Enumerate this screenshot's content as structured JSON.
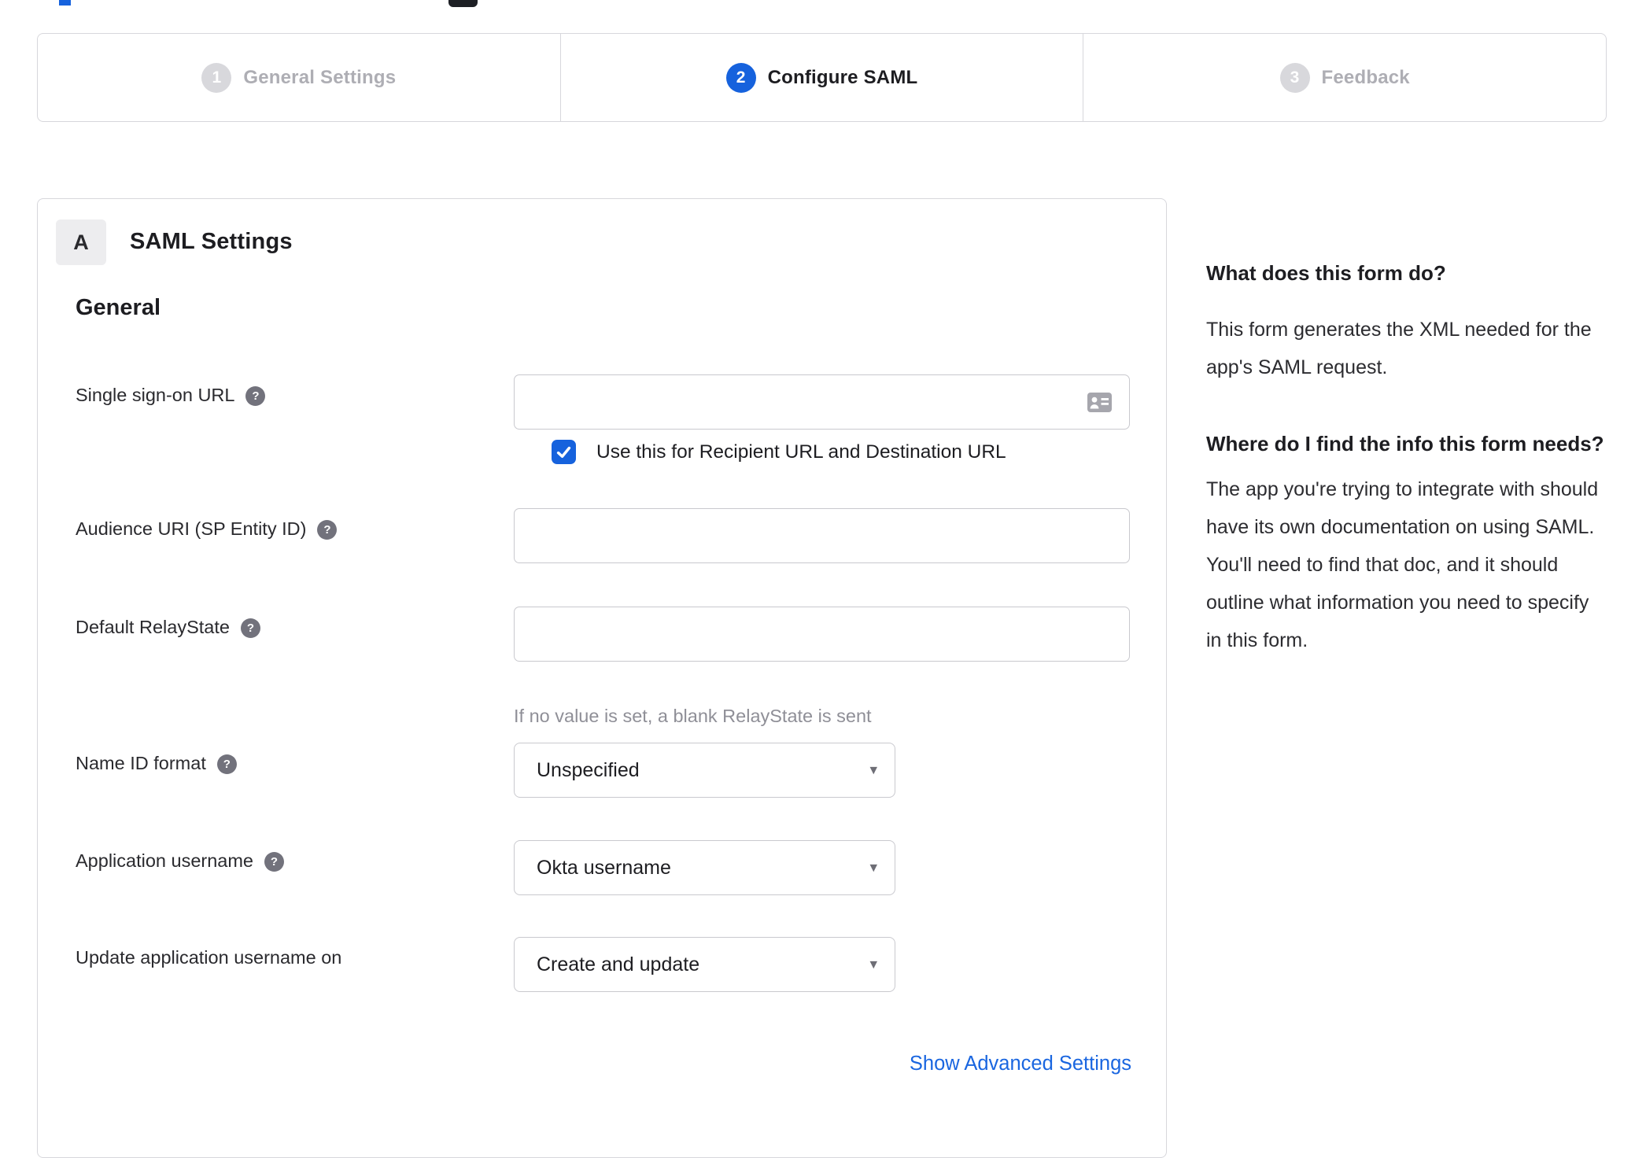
{
  "colors": {
    "accent_blue": "#1662dd",
    "step_inactive_gray": "#d8d8dc",
    "border_gray": "#d7d7dc",
    "dark_text": "#1d1d21",
    "muted_text": "#8f8f97"
  },
  "stepper": {
    "steps": [
      {
        "number": "1",
        "label": "General Settings",
        "active": false
      },
      {
        "number": "2",
        "label": "Configure SAML",
        "active": true
      },
      {
        "number": "3",
        "label": "Feedback",
        "active": false
      }
    ]
  },
  "panel": {
    "badge": "A",
    "title": "SAML Settings",
    "section_heading": "General"
  },
  "form": {
    "sso": {
      "label": "Single sign-on URL",
      "value": "",
      "checkbox_checked": true,
      "checkbox_label": "Use this for Recipient URL and Destination URL"
    },
    "audience": {
      "label": "Audience URI (SP Entity ID)",
      "value": ""
    },
    "relay_state": {
      "label": "Default RelayState",
      "value": "",
      "hint": "If no value is set, a blank RelayState is sent"
    },
    "name_id_format": {
      "label": "Name ID format",
      "selected": "Unspecified"
    },
    "application_username": {
      "label": "Application username",
      "selected": "Okta username"
    },
    "update_app_username": {
      "label": "Update application username on",
      "selected": "Create and update"
    },
    "advanced_link_label": "Show Advanced Settings"
  },
  "icons": {
    "help": "?",
    "caret_down": "▾"
  },
  "sidebar": {
    "q1_heading": "What does this form do?",
    "q1_body": "This form generates the XML needed for the app's SAML request.",
    "q2_heading": "Where do I find the info this form needs?",
    "q2_body": "The app you're trying to integrate with should have its own documentation on using SAML. You'll need to find that doc, and it should outline what information you need to specify in this form."
  }
}
